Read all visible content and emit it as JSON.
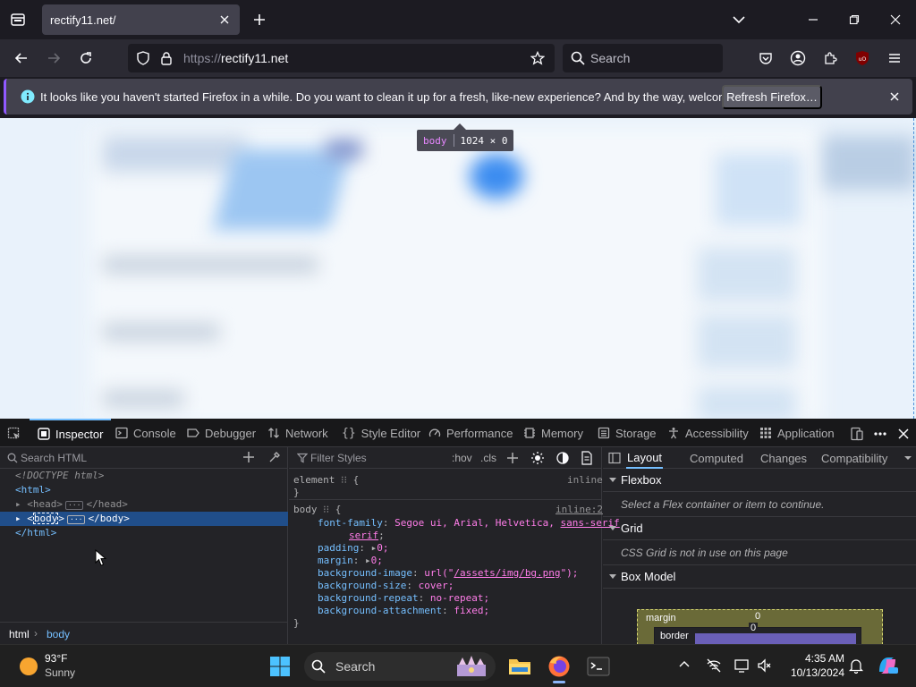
{
  "browser": {
    "tab": {
      "title": "rectify11.net/"
    },
    "url": {
      "scheme": "https://",
      "host": "rectify11.net"
    },
    "search": {
      "placeholder": "Search"
    }
  },
  "notification": {
    "message": "It looks like you haven't started Firefox in a while. Do you want to clean it up for a fresh, like-new experience? And by the way, welcome back!",
    "button_label": "Refresh Firefox…"
  },
  "page_tooltip": {
    "tag": "body",
    "dims": "1024 × 0"
  },
  "devtools": {
    "tabs": [
      "Inspector",
      "Console",
      "Debugger",
      "Network",
      "Style Editor",
      "Performance",
      "Memory",
      "Storage",
      "Accessibility",
      "Application"
    ],
    "markup": {
      "search_placeholder": "Search HTML",
      "lines": {
        "doctype": "<!DOCTYPE html>",
        "html_open": "<html>",
        "head_open": "<head>",
        "head_close": "</head>",
        "body_tag": "body",
        "body_close": "</body>",
        "html_close": "</html>"
      },
      "breadcrumbs": [
        "html",
        "body"
      ]
    },
    "rules": {
      "filter_placeholder": "Filter Styles",
      "hov": ":hov",
      "cls": ".cls",
      "element_selector": "element",
      "element_source": "inline",
      "body_selector": "body",
      "body_source": "inline:2",
      "declarations": [
        {
          "prop": "font-family",
          "value": "Segoe ui, Arial, Helvetica,",
          "link": "sans-serif"
        },
        {
          "prop": "padding",
          "value": "0;"
        },
        {
          "prop": "margin",
          "value": "0;"
        },
        {
          "prop": "background-image",
          "value_prefix": "url(\"",
          "link": "/assets/img/bg.png",
          "value_suffix": "\");"
        },
        {
          "prop": "background-size",
          "value": "cover;"
        },
        {
          "prop": "background-repeat",
          "value": "no-repeat;"
        },
        {
          "prop": "background-attachment",
          "value": "fixed;"
        }
      ],
      "brace_open": "{",
      "brace_close": "}",
      "semicolon": ";"
    },
    "layout": {
      "tabs": [
        "Layout",
        "Computed",
        "Changes",
        "Compatibility"
      ],
      "flexbox": {
        "title": "Flexbox",
        "message": "Select a Flex container or item to continue."
      },
      "grid": {
        "title": "Grid",
        "message": "CSS Grid is not in use on this page"
      },
      "boxmodel": {
        "title": "Box Model",
        "margin_label": "margin",
        "margin_value": "0",
        "border_label": "border",
        "border_value": "0"
      }
    }
  },
  "taskbar": {
    "weather": {
      "temp": "93°F",
      "condition": "Sunny"
    },
    "search_label": "Search",
    "clock": {
      "time": "4:35 AM",
      "date": "10/13/2024"
    }
  },
  "colors": {
    "accent": "#75bfff",
    "firefox_purple": "#9059ff",
    "selection": "#204e8a"
  }
}
